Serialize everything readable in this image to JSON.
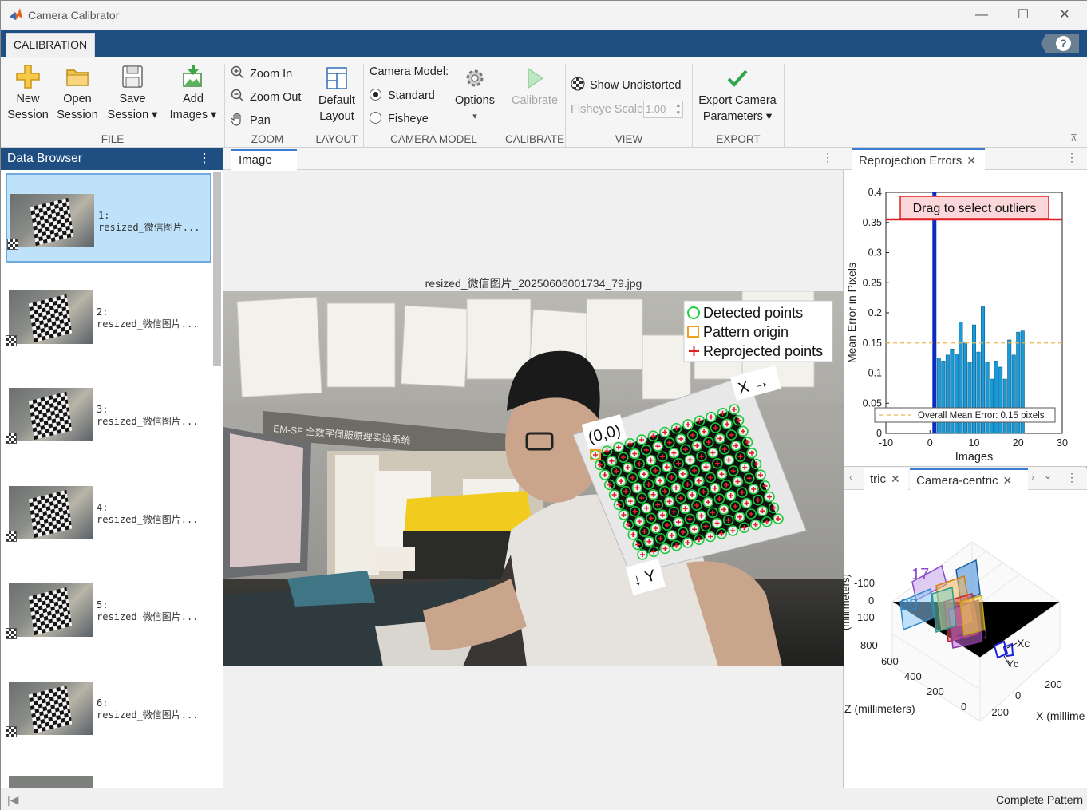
{
  "window": {
    "title": "Camera Calibrator",
    "minimize_icon": "minimize-icon",
    "maximize_icon": "maximize-icon",
    "close_icon": "close-icon"
  },
  "ribbon": {
    "tab": "CALIBRATION",
    "help_label": "?",
    "file": {
      "label": "FILE",
      "new_session": [
        "New",
        "Session"
      ],
      "open_session": [
        "Open",
        "Session"
      ],
      "save_session": [
        "Save",
        "Session ▾"
      ],
      "add_images": [
        "Add",
        "Images ▾"
      ]
    },
    "zoom": {
      "label": "ZOOM",
      "zoom_in": "Zoom In",
      "zoom_out": "Zoom Out",
      "pan": "Pan"
    },
    "layout": {
      "label": "LAYOUT",
      "default_layout": [
        "Default",
        "Layout"
      ]
    },
    "camera_model": {
      "label": "CAMERA MODEL",
      "heading": "Camera Model:",
      "standard": "Standard",
      "fisheye": "Fisheye",
      "selected": "Standard",
      "options": [
        "Options",
        "▾"
      ]
    },
    "calibrate": {
      "label": "CALIBRATE",
      "button": "Calibrate"
    },
    "view": {
      "label": "VIEW",
      "show_undistorted": "Show Undistorted",
      "fisheye_scale_label": "Fisheye Scale",
      "fisheye_scale_value": "1.00"
    },
    "export": {
      "label": "EXPORT",
      "button": [
        "Export Camera",
        "Parameters ▾"
      ]
    }
  },
  "data_browser": {
    "title": "Data Browser",
    "menu": "⋮",
    "items": [
      {
        "index": "1:",
        "name": "resized_微信图片...",
        "selected": true
      },
      {
        "index": "2:",
        "name": "resized_微信图片...",
        "selected": false
      },
      {
        "index": "3:",
        "name": "resized_微信图片...",
        "selected": false
      },
      {
        "index": "4:",
        "name": "resized_微信图片...",
        "selected": false
      },
      {
        "index": "5:",
        "name": "resized_微信图片...",
        "selected": false
      },
      {
        "index": "6:",
        "name": "resized_微信图片...",
        "selected": false
      }
    ]
  },
  "image_panel": {
    "tab": "Image",
    "menu": "⋮",
    "title": "resized_微信图片_20250606001734_79.jpg",
    "legend": [
      "Detected points",
      "Pattern origin",
      "Reprojected points"
    ],
    "origin_label": "(0,0)",
    "x_label": "X →",
    "y_label": "↓ Y"
  },
  "reprojection_panel": {
    "tab": "Reprojection Errors",
    "menu": "⋮",
    "outlier_label": "Drag to select outliers",
    "mean_label": "Overall Mean Error: 0.15 pixels"
  },
  "extrinsics_panel": {
    "tab_partial": "tric",
    "tab_active": "Camera-centric",
    "menu": "⋮",
    "z_axis_label": "Z (millimeters)",
    "x_axis_label": "X (millime",
    "y_axis_label": "(millimeters)",
    "y_ticks": [
      "-100",
      "0",
      "100"
    ],
    "z_ticks": [
      "800",
      "600",
      "400",
      "200",
      "0"
    ],
    "x_ticks": [
      "-200",
      "0",
      "200"
    ],
    "frame_labels": [
      "17",
      "20",
      "2",
      "0"
    ],
    "camera_axes": [
      "Xc",
      "Yc"
    ]
  },
  "status_bar": {
    "text": "Complete Pattern"
  },
  "chart_data": {
    "type": "bar",
    "title": "",
    "xlabel": "Images",
    "ylabel": "Mean Error in Pixels",
    "xlim": [
      -10,
      30
    ],
    "ylim": [
      0,
      0.4
    ],
    "xticks": [
      "-10",
      "0",
      "10",
      "20",
      "30"
    ],
    "yticks": [
      "0",
      "0.05",
      "0.1",
      "0.15",
      "0.2",
      "0.25",
      "0.3",
      "0.35",
      "0.4"
    ],
    "x": [
      1,
      2,
      3,
      4,
      5,
      6,
      7,
      8,
      9,
      10,
      11,
      12,
      13,
      14,
      15,
      16,
      17,
      18,
      19,
      20,
      21
    ],
    "values": [
      0.4,
      0.125,
      0.12,
      0.13,
      0.14,
      0.132,
      0.185,
      0.15,
      0.118,
      0.18,
      0.135,
      0.21,
      0.118,
      0.09,
      0.12,
      0.11,
      0.09,
      0.155,
      0.13,
      0.168,
      0.17
    ],
    "selected_index": 0,
    "mean": 0.15,
    "outlier_threshold": 0.355,
    "colors": {
      "bar": "#1a9ad6",
      "selected": "#0b2bbf",
      "threshold": "#e02020",
      "mean": "#e8b84a"
    }
  }
}
